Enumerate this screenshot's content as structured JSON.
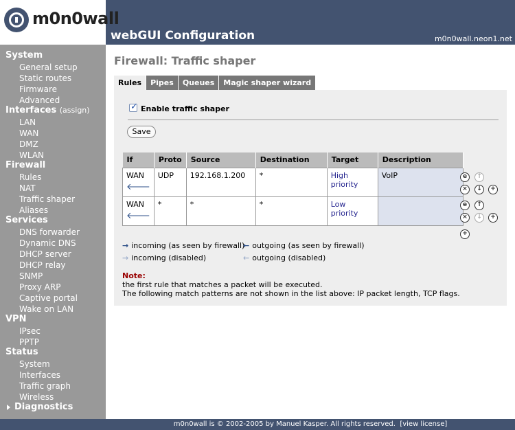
{
  "header": {
    "logo_text": "m0n0wall",
    "title": "webGUI Configuration",
    "hostname": "m0n0wall.neon1.net"
  },
  "sidebar": {
    "groups": [
      {
        "label": "System",
        "items": [
          "General setup",
          "Static routes",
          "Firmware",
          "Advanced"
        ]
      },
      {
        "label": "Interfaces",
        "suffix": "(assign)",
        "items": [
          "LAN",
          "WAN",
          "DMZ",
          "WLAN"
        ]
      },
      {
        "label": "Firewall",
        "items": [
          "Rules",
          "NAT",
          "Traffic shaper",
          "Aliases"
        ]
      },
      {
        "label": "Services",
        "items": [
          "DNS forwarder",
          "Dynamic DNS",
          "DHCP server",
          "DHCP relay",
          "SNMP",
          "Proxy ARP",
          "Captive portal",
          "Wake on LAN"
        ]
      },
      {
        "label": "VPN",
        "items": [
          "IPsec",
          "PPTP"
        ]
      },
      {
        "label": "Status",
        "items": [
          "System",
          "Interfaces",
          "Traffic graph",
          "Wireless"
        ]
      }
    ],
    "diagnostics": "Diagnostics"
  },
  "page_title": "Firewall: Traffic shaper",
  "tabs": [
    {
      "label": "Rules",
      "active": true
    },
    {
      "label": "Pipes",
      "active": false
    },
    {
      "label": "Queues",
      "active": false
    },
    {
      "label": "Magic shaper wizard",
      "active": false
    }
  ],
  "enable_label": "Enable traffic shaper",
  "enable_checked": true,
  "save_label": "Save",
  "table": {
    "headers": [
      "If",
      "Proto",
      "Source",
      "Destination",
      "Target",
      "Description"
    ],
    "rows": [
      {
        "if": "WAN",
        "proto": "UDP",
        "source": "192.168.1.200",
        "destination": "*",
        "target": "High priority",
        "description": "VoIP",
        "direction": "incoming"
      },
      {
        "if": "WAN",
        "proto": "*",
        "source": "*",
        "destination": "*",
        "target": "Low priority",
        "description": "",
        "direction": "incoming"
      }
    ]
  },
  "legend": {
    "incoming": "incoming (as seen by firewall)",
    "outgoing": "outgoing (as seen by firewall)",
    "incoming_disabled": "incoming (disabled)",
    "outgoing_disabled": "outgoing (disabled)"
  },
  "note": {
    "heading": "Note:",
    "line1": "the first rule that matches a packet will be executed.",
    "line2": "The following match patterns are not shown in the list above: IP packet length, TCP flags."
  },
  "footer": {
    "text": "m0n0wall is © 2002-2005 by Manuel Kasper. All rights reserved.",
    "license_link": "[view license]"
  },
  "colors": {
    "header_bg": "#435370",
    "sidebar_bg": "#999999",
    "panel_bg": "#eeeeee",
    "note_red": "#990000"
  }
}
